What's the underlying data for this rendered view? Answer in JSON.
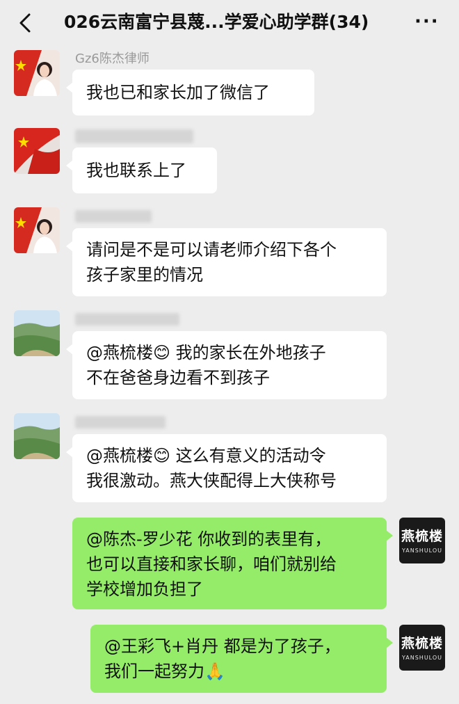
{
  "header": {
    "title": "026云南富宁县蔑...学爱心助学群(34)",
    "more_label": "···"
  },
  "messages": [
    {
      "sender": "Gz6陈杰律师",
      "lines": [
        "我也已和家长加了微信了"
      ]
    },
    {
      "sender": "",
      "lines": [
        "我也联系上了"
      ]
    },
    {
      "sender": "",
      "lines": [
        "请问是不是可以请老师介绍下各个",
        "孩子家里的情况"
      ]
    },
    {
      "sender": "",
      "lines": [
        "@燕梳楼😊  我的家长在外地孩子",
        "不在爸爸身边看不到孩子"
      ]
    },
    {
      "sender": "",
      "lines": [
        "@燕梳楼😊  这么有意义的活动令",
        "我很激动。燕大侠配得上大侠称号"
      ]
    },
    {
      "sender": "",
      "lines": [
        "@陈杰-罗少花  你收到的表里有，",
        "也可以直接和家长聊，咱们就别给",
        "学校增加负担了"
      ]
    },
    {
      "sender": "",
      "lines": [
        "@王彩飞+肖丹  都是为了孩子，",
        "我们一起努力🙏"
      ]
    }
  ],
  "self_avatar": {
    "logo_cn": "燕梳楼",
    "logo_en": "YANSHULOU"
  },
  "colors": {
    "background": "#ededed",
    "bubble_left": "#ffffff",
    "bubble_right": "#95ec69"
  },
  "icons": [
    "back-chevron-icon",
    "more-dots-icon"
  ]
}
